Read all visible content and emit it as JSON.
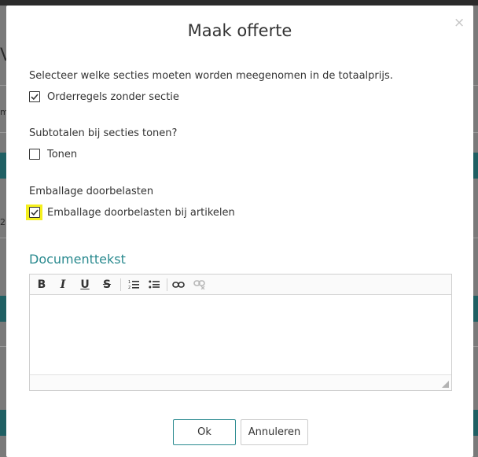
{
  "dialog": {
    "title": "Maak offerte",
    "close_glyph": "×",
    "sections_prompt": "Selecteer welke secties moeten worden meegenomen in de totaalprijs.",
    "sections_option": {
      "label": "Orderregels zonder sectie",
      "checked": true
    },
    "subtotals_prompt": "Subtotalen bij secties tonen?",
    "subtotals_option": {
      "label": "Tonen",
      "checked": false
    },
    "packaging_prompt": "Emballage doorbelasten",
    "packaging_option": {
      "label": "Emballage doorbelasten bij artikelen",
      "checked": true,
      "highlighted": true
    },
    "document_heading": "Documenttekst",
    "editor": {
      "toolbar": [
        {
          "name": "bold-button",
          "glyph": "B",
          "icon": "bold-icon"
        },
        {
          "name": "italic-button",
          "glyph": "I",
          "icon": "italic-icon"
        },
        {
          "name": "underline-button",
          "glyph": "U",
          "icon": "underline-icon"
        },
        {
          "name": "strikethrough-button",
          "glyph": "S",
          "icon": "strikethrough-icon"
        },
        {
          "name": "numbered-list-button",
          "icon": "numbered-list-icon"
        },
        {
          "name": "bulleted-list-button",
          "icon": "bulleted-list-icon"
        },
        {
          "name": "link-button",
          "icon": "link-icon"
        },
        {
          "name": "unlink-button",
          "icon": "unlink-icon",
          "disabled": true
        }
      ],
      "content": ""
    },
    "ok_label": "Ok",
    "cancel_label": "Annuleren"
  },
  "background_fragments": {
    "left_glyph_1": "V",
    "left_glyph_2": "m",
    "left_glyph_3": "2"
  },
  "colors": {
    "accent": "#2a8a8f",
    "highlight": "#f4ef1e",
    "backdrop_stripe": "#1f5f63"
  }
}
